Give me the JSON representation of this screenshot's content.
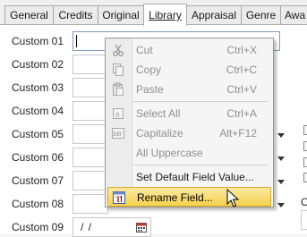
{
  "tabs": [
    {
      "label": "General"
    },
    {
      "label": "Credits"
    },
    {
      "label": "Original"
    },
    {
      "label": "Library",
      "active": true
    },
    {
      "label": "Appraisal"
    },
    {
      "label": "Genre"
    },
    {
      "label": "Awa"
    }
  ],
  "form": {
    "fields": [
      {
        "label": "Custom 01",
        "value": ""
      },
      {
        "label": "Custom 02",
        "value": ""
      },
      {
        "label": "Custom 03",
        "value": ""
      },
      {
        "label": "Custom 04",
        "value": ""
      },
      {
        "label": "Custom 05",
        "value": ""
      },
      {
        "label": "Custom 06",
        "value": ""
      },
      {
        "label": "Custom 07",
        "value": ""
      },
      {
        "label": "Custom 08",
        "value": ""
      },
      {
        "label": "Custom 09",
        "value": "/ /"
      }
    ],
    "cut_off_letter": "C"
  },
  "context_menu": {
    "items": [
      {
        "label": "Cut",
        "shortcut": "Ctrl+X",
        "icon": "scissors-icon",
        "enabled": false
      },
      {
        "label": "Copy",
        "shortcut": "Ctrl+C",
        "icon": "copy-icon",
        "enabled": false
      },
      {
        "label": "Paste",
        "shortcut": "Ctrl+V",
        "icon": "paste-icon",
        "enabled": false
      },
      {
        "label": "Select All",
        "shortcut": "Ctrl+A",
        "icon": "select-all-icon",
        "enabled": false
      },
      {
        "label": "Capitalize",
        "shortcut": "Alt+F12",
        "icon": "capitalize-icon",
        "enabled": false
      },
      {
        "label": "All Uppercase",
        "shortcut": "",
        "enabled": false
      },
      {
        "label": "Set Default Field Value...",
        "shortcut": "",
        "enabled": true
      },
      {
        "label": "Rename Field...",
        "shortcut": "",
        "icon": "rename-field-icon",
        "enabled": true,
        "highlighted": true
      }
    ]
  },
  "colors": {
    "highlight_top": "#fbe9a2",
    "highlight_bottom": "#f6d24f",
    "disabled_text": "#8f8f8f"
  }
}
